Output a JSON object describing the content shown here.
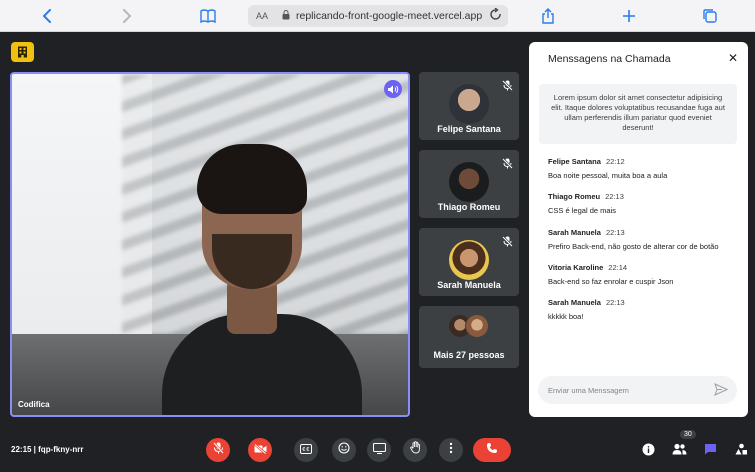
{
  "browser": {
    "url_aa": "AA",
    "url": "replicando-front-google-meet.vercel.app"
  },
  "meeting": {
    "featured": {
      "name": "Codifica"
    },
    "participants": [
      {
        "name": "Felipe Santana"
      },
      {
        "name": "Thiago Romeu"
      },
      {
        "name": "Sarah Manuela"
      }
    ],
    "more_label": "Mais 27 pessoas",
    "info": "22:15 | fqp-fkny-nrr",
    "people_count": "30"
  },
  "chat": {
    "title": "Menssagens na Chamada",
    "notice": "Lorem ipsum dolor sit amet consectetur adipisicing elit. Itaque dolores voluptatibus recusandae fuga aut ullam perferendis illum pariatur quod eveniet deserunt!",
    "messages": [
      {
        "author": "Felipe Santana",
        "time": "22:12",
        "text": "Boa noite pessoal, muita boa a aula"
      },
      {
        "author": "Thiago Romeu",
        "time": "22:13",
        "text": "CSS é legal de mais"
      },
      {
        "author": "Sarah Manuela",
        "time": "22:13",
        "text": "Prefiro Back-end, não gosto de alterar cor de botão"
      },
      {
        "author": "Vitoria Karoline",
        "time": "22:14",
        "text": "Back-end so faz enrolar e cuspir Json"
      },
      {
        "author": "Sarah Manuela",
        "time": "22:13",
        "text": "kkkkk boa!"
      }
    ],
    "input_placeholder": "Enviar uma Menssagem"
  },
  "colors": {
    "accent": "#8a8ff7",
    "end_call": "#ea4335",
    "chat_icon": "#6c63f2",
    "logo": "#f2c00f"
  }
}
